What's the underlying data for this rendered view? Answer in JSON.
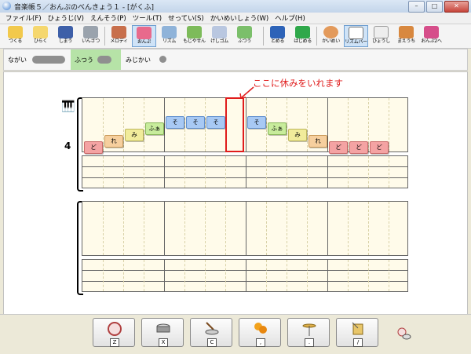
{
  "window": {
    "title": "音楽帳５／おんぷのべんきょう１ - [がくふ]"
  },
  "menu": [
    "ファイル(F)",
    "ひょうじ(V)",
    "えんそう(P)",
    "ツール(T)",
    "せってい(S)",
    "かいめいしょう(W)",
    "ヘルプ(H)"
  ],
  "toolbar": [
    {
      "label": "つくる",
      "icon": "new-icon"
    },
    {
      "label": "ひらく",
      "icon": "open-folder-icon"
    },
    {
      "label": "しまう",
      "icon": "save-disk-icon"
    },
    {
      "label": "いんさつ",
      "icon": "printer-icon"
    },
    {
      "label": "メロディ",
      "icon": "melody-icon"
    },
    {
      "label": "おんぷ",
      "icon": "note-eraser-icon"
    },
    {
      "label": "リズム",
      "icon": "drum-icon"
    },
    {
      "label": "もじやせん",
      "icon": "text-icon"
    },
    {
      "label": "けしゴム",
      "icon": "eraser-icon"
    },
    {
      "label": "ふつう",
      "icon": "turtle-icon"
    },
    {
      "label": "とめる",
      "icon": "stop-icon"
    },
    {
      "label": "はじめる",
      "icon": "play-icon"
    },
    {
      "label": "かいめい",
      "icon": "face-icon"
    },
    {
      "label": "リズムバー",
      "icon": "rhythm-bar-icon"
    },
    {
      "label": "ひょうし",
      "icon": "time-signature-icon"
    },
    {
      "label": "まえうち",
      "icon": "metronome-icon"
    },
    {
      "label": "おんぷ2へ",
      "icon": "next-icon"
    }
  ],
  "speed": {
    "long": "ながい",
    "normal": "ふつう",
    "short": "みじかい"
  },
  "score": {
    "time_signature": "4",
    "annotation": "ここに休みをいれます",
    "notes": [
      {
        "label": "ど",
        "kind": "do"
      },
      {
        "label": "れ",
        "kind": "re"
      },
      {
        "label": "み",
        "kind": "mi"
      },
      {
        "label": "ふぁ",
        "kind": "fa"
      },
      {
        "label": "そ",
        "kind": "so"
      },
      {
        "label": "そ",
        "kind": "so"
      },
      {
        "label": "そ",
        "kind": "so"
      },
      {
        "label": "そ",
        "kind": "so"
      },
      {
        "label": "ふぁ",
        "kind": "fa"
      },
      {
        "label": "み",
        "kind": "mi"
      },
      {
        "label": "れ",
        "kind": "re"
      },
      {
        "label": "ど",
        "kind": "do"
      },
      {
        "label": "ど",
        "kind": "do"
      },
      {
        "label": "ど",
        "kind": "do"
      }
    ]
  },
  "percussion": [
    {
      "key": "Z",
      "icon": "bass-drum-icon"
    },
    {
      "key": "X",
      "icon": "snare-drum-icon"
    },
    {
      "key": "C",
      "icon": "drum-sticks-icon"
    },
    {
      "key": ",",
      "icon": "maracas-icon"
    },
    {
      "key": ".",
      "icon": "hi-hat-icon"
    },
    {
      "key": "/",
      "icon": "tambourine-icon"
    }
  ],
  "colors": {
    "accent": "#e01c1c",
    "do": "#f4a3a3",
    "re": "#f6cf9e",
    "mi": "#f1ec9b",
    "fa": "#c8ec9c",
    "so": "#a8c9f4"
  }
}
